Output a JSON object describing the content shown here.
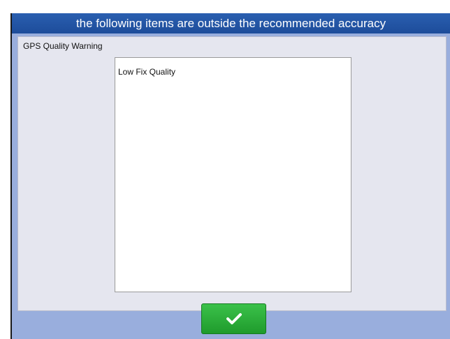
{
  "dialog": {
    "title": "the following items are outside the recommended accuracy",
    "panel_label": "GPS Quality Warning",
    "items": [
      "Low Fix Quality"
    ],
    "confirm_icon": "checkmark-icon",
    "colors": {
      "title_bar": "#2058ab",
      "frame": "#99aedd",
      "panel": "#e5e6ef",
      "confirm_button": "#2bad3a"
    }
  }
}
